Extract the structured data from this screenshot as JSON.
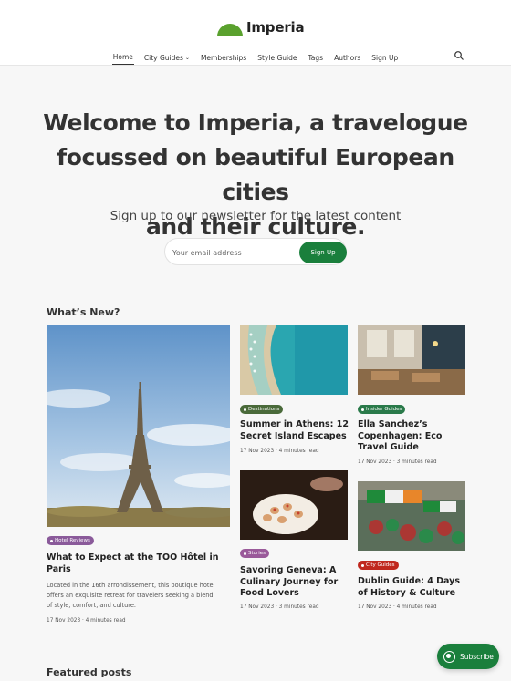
{
  "site": {
    "name": "Imperia",
    "accent": "#5aa12e",
    "button_color": "#1a7f3c"
  },
  "nav": {
    "items": [
      {
        "label": "Home",
        "active": true
      },
      {
        "label": "City Guides",
        "dropdown": true
      },
      {
        "label": "Memberships"
      },
      {
        "label": "Style Guide"
      },
      {
        "label": "Tags"
      },
      {
        "label": "Authors"
      },
      {
        "label": "Sign Up"
      }
    ],
    "search_icon": "search-icon"
  },
  "hero": {
    "title_lines": [
      "Welcome to Imperia, a travelogue",
      "focussed on beautiful European cities",
      "and their culture."
    ],
    "subtitle": "Sign up to our newsletter for the latest content",
    "email_placeholder": "Your email address",
    "signup_label": "Sign Up"
  },
  "whats_new": {
    "heading": "What’s New?",
    "featured": {
      "tag": "Hotel Reviews",
      "tag_color": "#8a5a9a",
      "title": "What to Expect at the TOO Hôtel in Paris",
      "excerpt": "Located in the 16th arrondissement, this boutique hotel offers an exquisite retreat for travelers seeking a blend of style, comfort, and culture.",
      "meta": "17 Nov 2023 · 4 minutes read"
    },
    "cards": [
      {
        "tag": "Destinations",
        "tag_color": "#4a6a3a",
        "title": "Summer in Athens: 12 Secret Island Escapes",
        "meta": "17 Nov 2023 · 4 minutes read"
      },
      {
        "tag": "Insider Guides",
        "tag_color": "#2a7a4a",
        "title": "Ella Sanchez’s Copenhagen: Eco Travel Guide",
        "meta": "17 Nov 2023 · 3 minutes read"
      },
      {
        "tag": "Stories",
        "tag_color": "#9a5a9a",
        "title": "Savoring Geneva: A Culinary Journey for Food Lovers",
        "meta": "17 Nov 2023 · 3 minutes read"
      },
      {
        "tag": "City Guides",
        "tag_color": "#c0281e",
        "title": "Dublin Guide: 4 Days of History & Culture",
        "meta": "17 Nov 2023 · 4 minutes read"
      }
    ]
  },
  "featured_posts": {
    "heading": "Featured posts"
  },
  "floating": {
    "subscribe_label": "Subscribe"
  }
}
